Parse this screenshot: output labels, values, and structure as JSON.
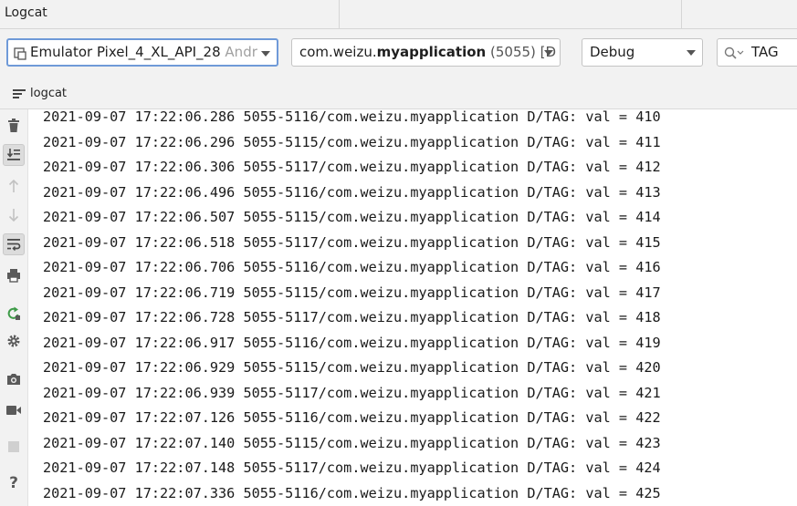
{
  "window": {
    "title": "Logcat"
  },
  "toolbar": {
    "device": {
      "name": "Emulator Pixel_4_XL_API_28",
      "suffix": "Andr"
    },
    "process": {
      "prefix": "com.weizu.",
      "bold": "myapplication",
      "pid": " (5055)",
      "suffix": " [D"
    },
    "level": "Debug",
    "search": "TAG"
  },
  "tab": {
    "label": "logcat"
  },
  "gutter": {
    "icons": [
      "trash-icon",
      "scroll-to-end-icon",
      "arrow-up-icon",
      "arrow-down-icon",
      "soft-wrap-icon",
      "print-icon",
      "restart-icon",
      "settings-icon",
      "screenshot-icon",
      "screen-record-icon",
      "stop-icon",
      "help-icon"
    ]
  },
  "log": {
    "lines": [
      "2021-09-07 17:22:06.286 5055-5116/com.weizu.myapplication D/TAG: val = 410",
      "2021-09-07 17:22:06.296 5055-5115/com.weizu.myapplication D/TAG: val = 411",
      "2021-09-07 17:22:06.306 5055-5117/com.weizu.myapplication D/TAG: val = 412",
      "2021-09-07 17:22:06.496 5055-5116/com.weizu.myapplication D/TAG: val = 413",
      "2021-09-07 17:22:06.507 5055-5115/com.weizu.myapplication D/TAG: val = 414",
      "2021-09-07 17:22:06.518 5055-5117/com.weizu.myapplication D/TAG: val = 415",
      "2021-09-07 17:22:06.706 5055-5116/com.weizu.myapplication D/TAG: val = 416",
      "2021-09-07 17:22:06.719 5055-5115/com.weizu.myapplication D/TAG: val = 417",
      "2021-09-07 17:22:06.728 5055-5117/com.weizu.myapplication D/TAG: val = 418",
      "2021-09-07 17:22:06.917 5055-5116/com.weizu.myapplication D/TAG: val = 419",
      "2021-09-07 17:22:06.929 5055-5115/com.weizu.myapplication D/TAG: val = 420",
      "2021-09-07 17:22:06.939 5055-5117/com.weizu.myapplication D/TAG: val = 421",
      "2021-09-07 17:22:07.126 5055-5116/com.weizu.myapplication D/TAG: val = 422",
      "2021-09-07 17:22:07.140 5055-5115/com.weizu.myapplication D/TAG: val = 423",
      "2021-09-07 17:22:07.148 5055-5117/com.weizu.myapplication D/TAG: val = 424",
      "2021-09-07 17:22:07.336 5055-5116/com.weizu.myapplication D/TAG: val = 425"
    ]
  }
}
